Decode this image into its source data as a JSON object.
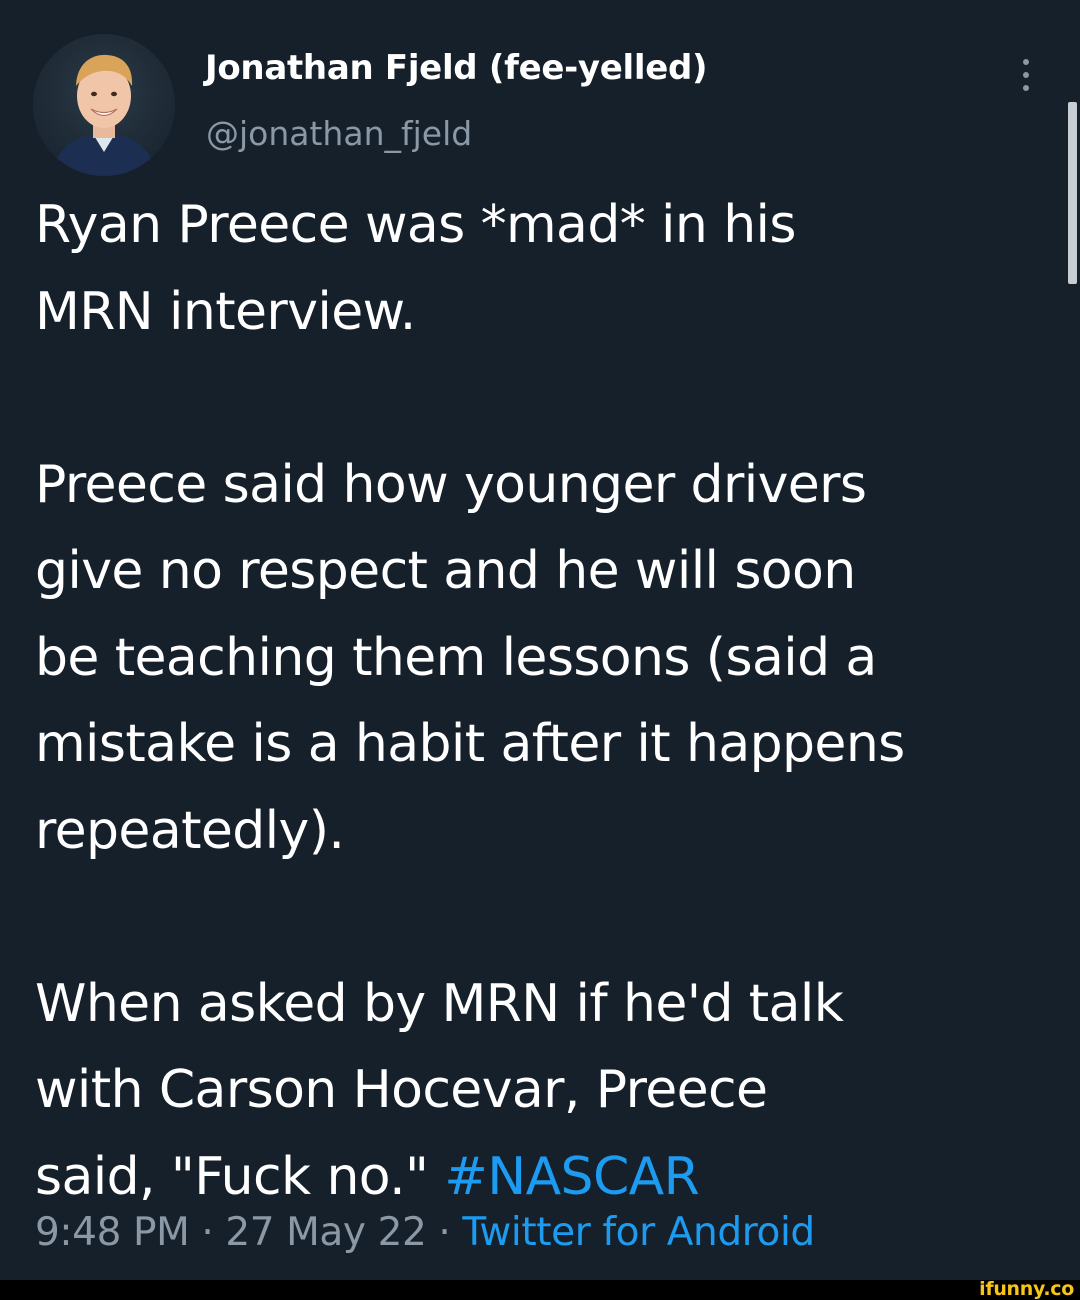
{
  "tweet": {
    "author": {
      "display_name": "Jonathan Fjeld (fee-yelled)",
      "handle": "@jonathan_fjeld"
    },
    "paragraphs": [
      [
        "Ryan Preece was *mad* in his",
        "MRN interview."
      ],
      [
        "Preece said how younger drivers",
        "give no respect and he will soon",
        "be teaching them lessons (said a",
        "mistake is a habit after it happens",
        "repeatedly)."
      ],
      [
        "When asked by MRN if he'd talk",
        "with Carson Hocevar, Preece",
        "said, \"Fuck no.\""
      ]
    ],
    "hashtag": "#NASCAR",
    "time": "9:48 PM",
    "date": "27 May 22",
    "separator": "·",
    "source": "Twitter for Android",
    "more_icon": "more-vertical-icon"
  },
  "watermark": "ifunny.co",
  "colors": {
    "background": "#15202b",
    "text": "#ffffff",
    "secondary": "#8b98a5",
    "link": "#1d9bf0"
  }
}
